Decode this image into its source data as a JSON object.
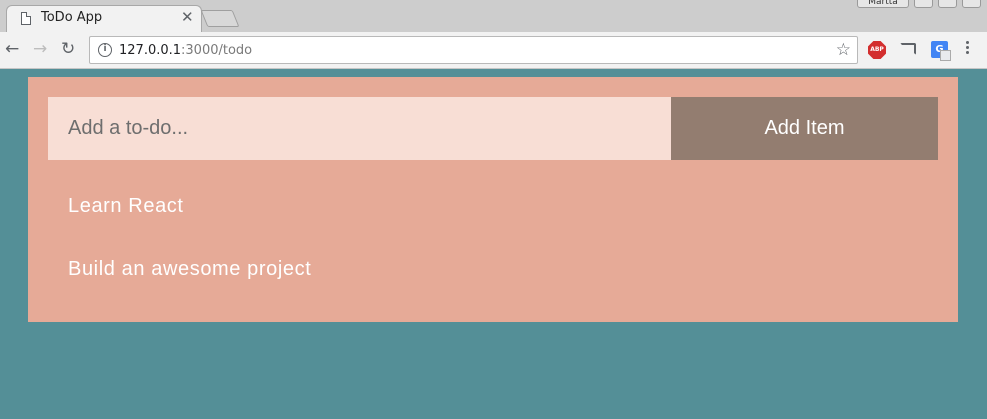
{
  "browser": {
    "tab_title": "ToDo App",
    "url_host": "127.0.0.1",
    "url_rest": ":3000/todo",
    "window_user": "Martta",
    "extensions": [
      "abp-icon",
      "cast-icon",
      "google-translate-icon"
    ],
    "abp_label": "ABP"
  },
  "app": {
    "input_placeholder": "Add a to-do...",
    "add_button_label": "Add Item",
    "items": [
      "Learn React",
      "Build an awesome project"
    ]
  },
  "colors": {
    "page_background": "#548f97",
    "card_background": "#e6aa97",
    "input_background": "#f8ded5",
    "button_background": "#937d70",
    "item_text": "#ffffff"
  }
}
